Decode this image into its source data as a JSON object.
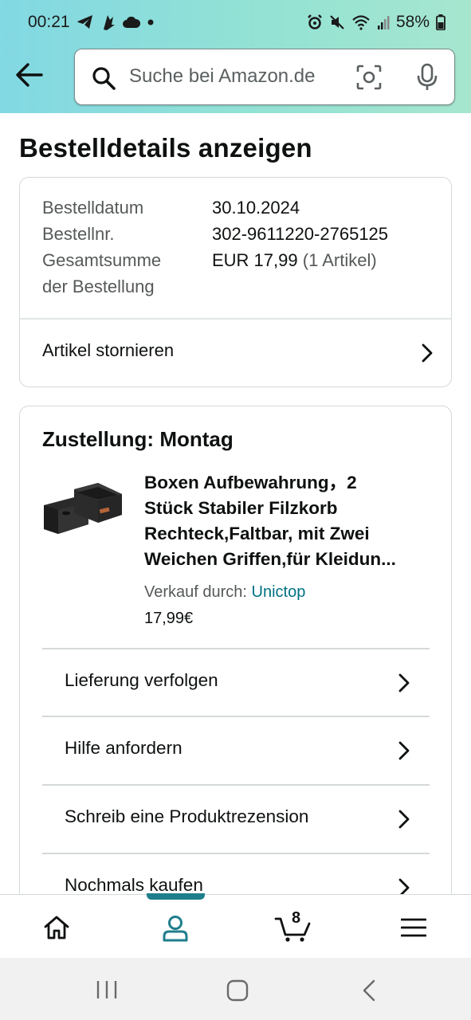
{
  "status": {
    "time": "00:21",
    "battery": "58%"
  },
  "search": {
    "placeholder": "Suche bei Amazon.de"
  },
  "page_title": "Bestelldetails anzeigen",
  "order_summary": {
    "date_label": "Bestelldatum",
    "date_value": "30.10.2024",
    "number_label": "Bestellnr.",
    "number_value": "302-9611220-2765125",
    "total_label_line1": "Gesamtsumme",
    "total_label_line2": "der Bestellung",
    "total_value": "EUR 17,99",
    "total_items": "(1 Artikel)",
    "cancel_label": "Artikel stornieren"
  },
  "shipment": {
    "heading": "Zustellung: Montag",
    "product": {
      "title_lines": [
        "Boxen Aufbewahrung，2",
        "Stück Stabiler Filzkorb",
        "Rechteck,Faltbar, mit Zwei",
        "Weichen Griffen,für Kleidun..."
      ],
      "seller_label": "Verkauf durch:",
      "seller_name": "Unictop",
      "price": "17,99€"
    },
    "actions": [
      {
        "label": "Lieferung verfolgen"
      },
      {
        "label": "Hilfe anfordern"
      },
      {
        "label": "Schreib eine Produktrezension"
      },
      {
        "label": "Nochmals kaufen"
      }
    ]
  },
  "bottom_nav": {
    "cart_count": "8",
    "items": [
      "home-icon",
      "account-icon",
      "cart-icon",
      "menu-icon"
    ],
    "active": "account-icon",
    "accent_color": "#1f7e8c"
  },
  "colors": {
    "link": "#007185",
    "muted": "#565959",
    "text": "#0f1111"
  }
}
